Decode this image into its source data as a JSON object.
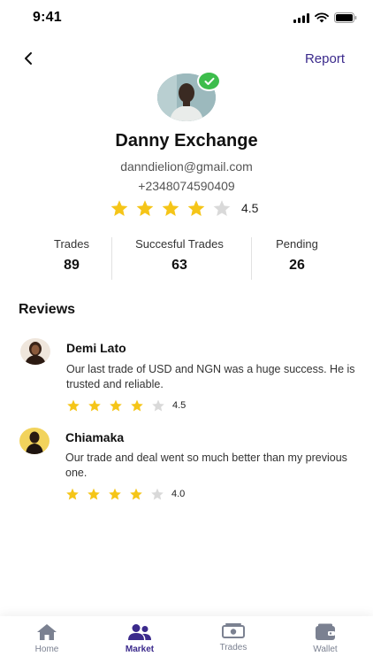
{
  "status_bar": {
    "time": "9:41"
  },
  "header": {
    "back_icon": "chevron-left-icon",
    "report_label": "Report"
  },
  "profile": {
    "name": "Danny Exchange",
    "email": "danndielion@gmail.com",
    "phone": "+2348074590409",
    "verified": true,
    "rating": 4.5,
    "rating_label": "4.5"
  },
  "stats": [
    {
      "label": "Trades",
      "value": "89"
    },
    {
      "label": "Succesful Trades",
      "value": "63"
    },
    {
      "label": "Pending",
      "value": "26"
    }
  ],
  "reviews": {
    "title": "Reviews",
    "items": [
      {
        "name": "Demi Lato",
        "text": "Our last trade of USD and NGN was a huge success. He is trusted and reliable.",
        "rating": 4.5,
        "rating_label": "4.5"
      },
      {
        "name": "Chiamaka",
        "text": "Our trade and deal went so much better than my previous one.",
        "rating": 4.0,
        "rating_label": "4.0"
      }
    ]
  },
  "tabs": [
    {
      "label": "Home",
      "icon": "home-icon",
      "active": false
    },
    {
      "label": "Market",
      "icon": "users-icon",
      "active": true
    },
    {
      "label": "Trades",
      "icon": "money-icon",
      "active": false
    },
    {
      "label": "Wallet",
      "icon": "wallet-icon",
      "active": false
    }
  ],
  "colors": {
    "accent": "#3b2a8c",
    "star_filled": "#f5c518",
    "star_empty": "#d9d9d9",
    "verified": "#3dbd4c"
  }
}
